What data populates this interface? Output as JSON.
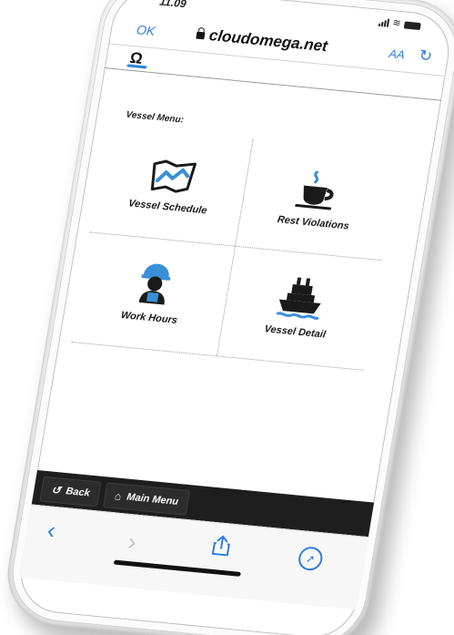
{
  "status": {
    "time": "11.09"
  },
  "browser": {
    "ok_label": "OK",
    "url": "cloudomega.net",
    "text_size_label": "AA"
  },
  "site": {
    "logo_text": "Ω"
  },
  "menu": {
    "title": "Vessel Menu:",
    "items": [
      {
        "label": "Vessel Schedule",
        "icon": "map-route-icon"
      },
      {
        "label": "Rest Violations",
        "icon": "coffee-cup-icon"
      },
      {
        "label": "Work Hours",
        "icon": "worker-helmet-icon"
      },
      {
        "label": "Vessel Detail",
        "icon": "ship-icon"
      }
    ]
  },
  "web_nav": {
    "back_label": "Back",
    "main_menu_label": "Main Menu"
  },
  "colors": {
    "accent": "#2f7ee0",
    "icon_blue": "#3a8fd8",
    "nav_bar": "#1e1e1e"
  }
}
